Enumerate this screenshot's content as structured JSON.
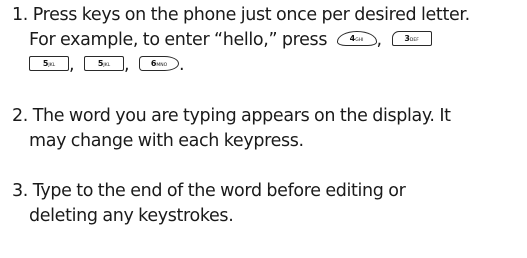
{
  "steps": [
    {
      "number": "1.",
      "text_line1": "Press keys on the phone just once per desired letter.",
      "text_line2": "For example, to enter “hello,” press",
      "keys_line2": [
        {
          "number": "4",
          "letters": "GHI"
        },
        {
          "number": "3",
          "letters": "DEF"
        }
      ],
      "keys_line3": [
        {
          "number": "5",
          "letters": "JKL"
        },
        {
          "number": "5",
          "letters": "JKL"
        },
        {
          "number": "6",
          "letters": "MNO"
        }
      ],
      "separator": ",",
      "terminator": "."
    },
    {
      "number": "2.",
      "text_line1": "The word you are typing appears on the display. It",
      "text_line2": "may change with each keypress."
    },
    {
      "number": "3.",
      "text_line1": "Type to the end of the word before editing or",
      "text_line2": "deleting any keystrokes."
    }
  ]
}
